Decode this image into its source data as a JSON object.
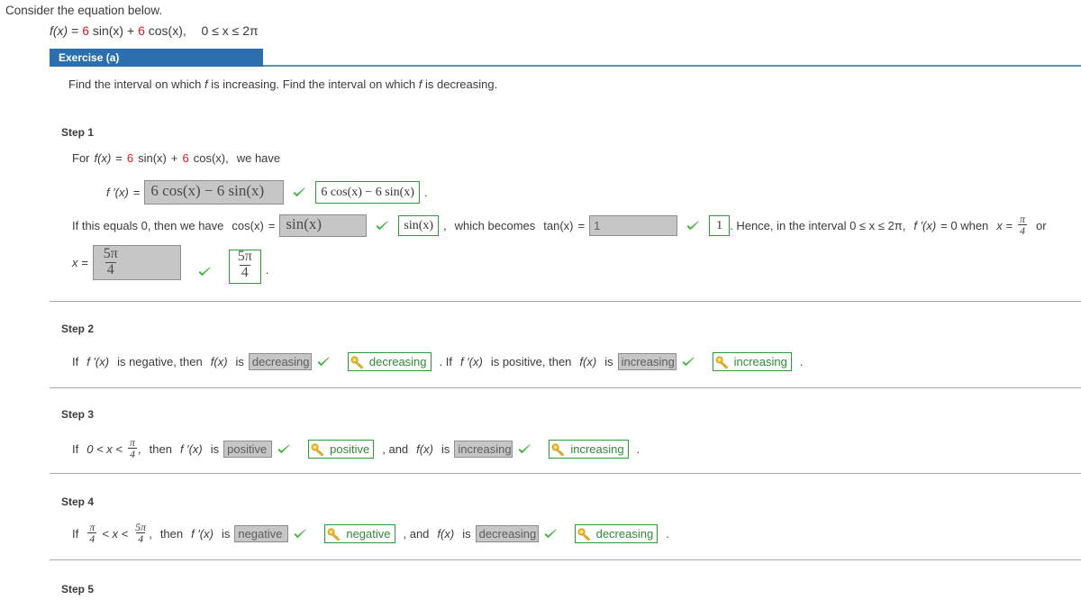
{
  "intro": {
    "prompt": "Consider the equation below.",
    "equation": {
      "fx": "f(x)",
      "eq": "=",
      "coef1": "6",
      "term1": "sin(x)",
      "plus": "+",
      "coef2": "6",
      "term2": "cos(x),",
      "domain": "0 ≤ x ≤ 2π"
    }
  },
  "exercise": {
    "tab_label": "Exercise (a)",
    "instructions": "Find the interval on which f is increasing. Find the interval on which f is decreasing."
  },
  "steps": [
    {
      "label": "Step 1",
      "text": {
        "for": "For",
        "fx": "f(x)",
        "eq": "=",
        "c1": "6",
        "t1": "sin(x)",
        "plus": "+",
        "c2": "6",
        "t2": "cos(x),",
        "wehave": "we have",
        "fprime": "f ′(x)",
        "eq2": "=",
        "derivative_answer": "6 cos(x) − 6 sin(x)",
        "derivative_key": "6 cos(x) − 6 sin(x)",
        "period": ".",
        "ifzero": "If this equals 0, then we have",
        "cosx": "cos(x)",
        "eq3": "=",
        "sin_answer": "sin(x)",
        "sin_key": "sin(x)",
        "comma": ",",
        "whichbecomes": "which becomes",
        "tanx": "tan(x)",
        "eq4": "=",
        "tan_answer": "1",
        "tan_key": "1",
        "hence": ". Hence, in the interval 0 ≤ x ≤ 2π,",
        "fprime2": "f ′(x)",
        "zerowhen": "= 0  when",
        "xeq": "x =",
        "pi_over_4_num": "π",
        "pi_over_4_den": "4",
        "or": "or",
        "xeq2": "x =",
        "x_answer_num": "5π",
        "x_answer_den": "4",
        "x_key_num": "5π",
        "x_key_den": "4",
        "final_period": "."
      }
    },
    {
      "label": "Step 2",
      "text": {
        "if": "If",
        "fprime": "f ′(x)",
        "isneg": "is negative, then",
        "fx": "f(x)",
        "is": "is",
        "answer1": "decreasing",
        "key1": "decreasing",
        "mid": ". If",
        "fprime2": "f ′(x)",
        "ispos": "is positive, then",
        "fx2": "f(x)",
        "is2": "is",
        "answer2": "increasing",
        "key2": "increasing",
        "end": "."
      }
    },
    {
      "label": "Step 3",
      "text": {
        "if": "If",
        "ineq_left": "0 < x <",
        "frac_num": "π",
        "frac_den": "4",
        "comma": ",",
        "then": "then",
        "fprime": "f ′(x)",
        "is": "is",
        "answer1": "positive",
        "key1": "positive",
        "and": ", and",
        "fx": "f(x)",
        "is2": "is",
        "answer2": "increasing",
        "key2": "increasing",
        "end": "."
      }
    },
    {
      "label": "Step 4",
      "text": {
        "if": "If",
        "frac1_num": "π",
        "frac1_den": "4",
        "lt1": "< x <",
        "frac2_num": "5π",
        "frac2_den": "4",
        "comma": ",",
        "then": "then",
        "fprime": "f ′(x)",
        "is": "is",
        "answer1": "negative",
        "key1": "negative",
        "and": ", and",
        "fx": "f(x)",
        "is2": "is",
        "answer2": "decreasing",
        "key2": "decreasing",
        "end": "."
      }
    },
    {
      "label": "Step 5",
      "text": {}
    }
  ],
  "icons": {
    "check": "checkmark-icon",
    "key": "key-icon"
  },
  "colors": {
    "tab_blue": "#2c6fad",
    "rule_blue": "#5b94ad",
    "answer_gray": "#c6c6c6",
    "key_green": "#2a9a3a",
    "check_green": "#3fae3f",
    "red_coef": "#cc1f1f"
  }
}
